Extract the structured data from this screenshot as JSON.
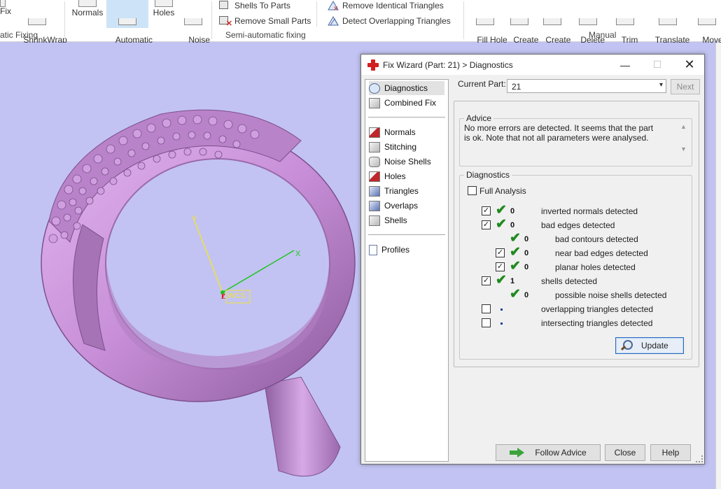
{
  "ribbon": {
    "buttons": [
      {
        "label": "Fix"
      },
      {
        "label": "ShrinkWrap\nPart"
      },
      {
        "label": "Normals"
      },
      {
        "label": "Automatic\nStitching"
      },
      {
        "label": "Holes"
      },
      {
        "label": "Noise\nShells"
      },
      {
        "label": "Fill Hole\nMode"
      },
      {
        "label": "Create\nBridge"
      },
      {
        "label": "Create\nTriangle"
      },
      {
        "label": "Delete\nTriangle"
      },
      {
        "label": "Trim\nTriangles"
      },
      {
        "label": "Translate\nPart Points"
      },
      {
        "label": "Move Po\nPoints"
      }
    ],
    "small": {
      "shells_to_parts": "Shells To Parts",
      "remove_small_parts": "Remove Small Parts",
      "remove_identical": "Remove Identical Triangles",
      "detect_overlapping": "Detect Overlapping Triangles"
    },
    "groups": {
      "auto": "atic Fixing",
      "semi": "Semi-automatic fixing",
      "manual": "Manual"
    }
  },
  "viewport": {
    "axis_x": "X",
    "axis_y": "Y",
    "axis_z": "Z",
    "wcs": "WCS",
    "colors": {
      "bg": "#c2c3f2",
      "ring": "#c88fd8"
    }
  },
  "dialog": {
    "title": "Fix Wizard (Part: 21) > Diagnostics",
    "minimize": "—",
    "maximize": "☐",
    "close": "✕",
    "nav": [
      {
        "label": "Diagnostics"
      },
      {
        "label": "Combined Fix"
      },
      {
        "label": "Normals"
      },
      {
        "label": "Stitching"
      },
      {
        "label": "Noise Shells"
      },
      {
        "label": "Holes"
      },
      {
        "label": "Triangles"
      },
      {
        "label": "Overlaps"
      },
      {
        "label": "Shells"
      },
      {
        "label": "Profiles"
      }
    ],
    "current_part_label": "Current Part:",
    "current_part_value": "21",
    "next_label": "Next",
    "advice_legend": "Advice",
    "advice_text": "No more errors are detected. It seems that the part is ok. Note that not all parameters were analysed.",
    "diagnostics_legend": "Diagnostics",
    "full_analysis": "Full Analysis",
    "rows": [
      {
        "count": "0",
        "label": "inverted normals detected"
      },
      {
        "count": "0",
        "label": "bad edges detected"
      },
      {
        "count": "0",
        "label": "bad contours detected"
      },
      {
        "count": "0",
        "label": "near bad edges detected"
      },
      {
        "count": "0",
        "label": "planar holes detected"
      },
      {
        "count": "1",
        "label": "shells detected"
      },
      {
        "count": "0",
        "label": "possible noise shells detected"
      },
      {
        "count": "",
        "label": "overlapping triangles detected"
      },
      {
        "count": "",
        "label": "intersecting triangles detected"
      }
    ],
    "update_label": "Update",
    "follow_advice_label": "Follow Advice",
    "close_label": "Close",
    "help_label": "Help"
  }
}
